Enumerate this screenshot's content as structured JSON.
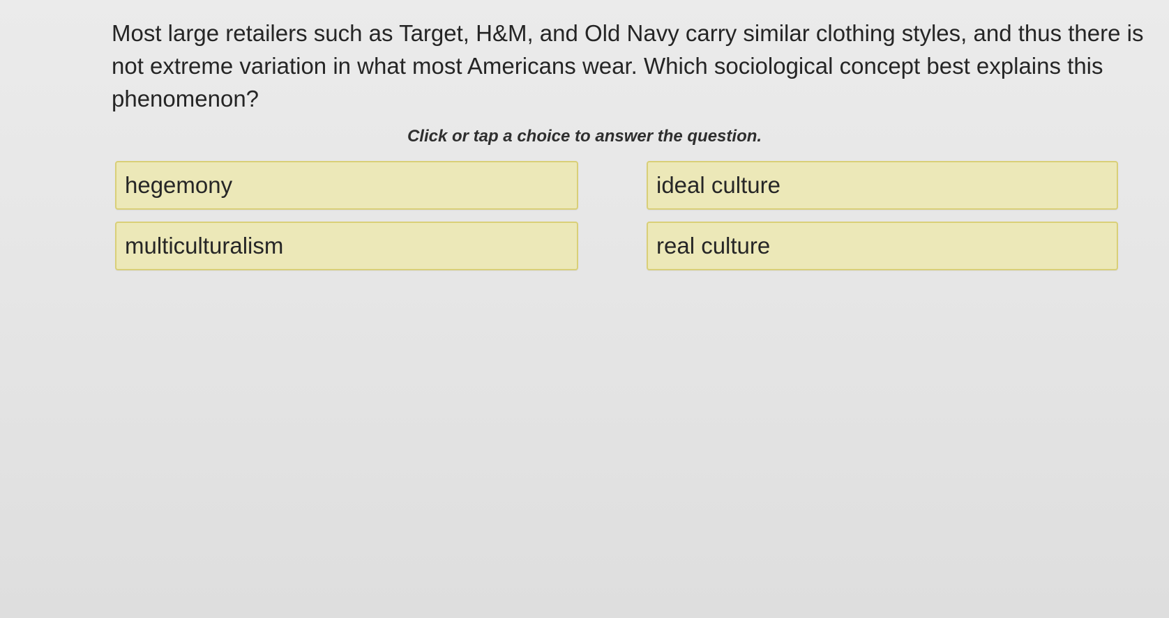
{
  "question": {
    "text": "Most large retailers such as Target, H&M, and Old Navy carry similar clothing styles, and thus there is not extreme variation in what most Americans wear. Which sociological concept best explains this phenomenon?"
  },
  "instruction": "Click or tap a choice to answer the question.",
  "choices": [
    {
      "label": "hegemony"
    },
    {
      "label": "ideal culture"
    },
    {
      "label": "multiculturalism"
    },
    {
      "label": "real culture"
    }
  ],
  "colors": {
    "choice_background": "#ece8b8",
    "choice_border": "#d9cf78",
    "page_background": "#e8e8e8"
  }
}
